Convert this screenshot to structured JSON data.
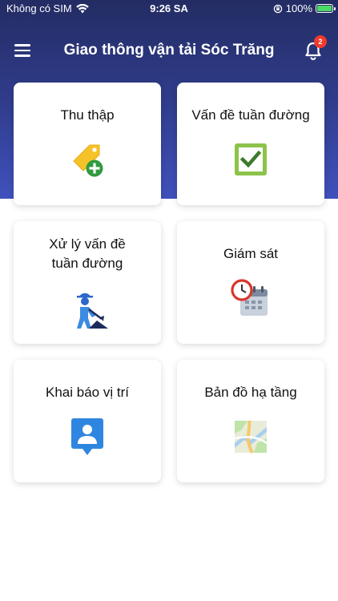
{
  "status_bar": {
    "carrier": "Không có SIM",
    "time": "9:26 SA",
    "battery": "100%",
    "battery_level": 1.0
  },
  "app_bar": {
    "title": "Giao thông vận tải Sóc Trăng",
    "notification_count": "2",
    "icons": {
      "menu": "hamburger-menu-icon",
      "notifications": "bell-icon"
    }
  },
  "colors": {
    "header_top": "#232c63",
    "header_bottom": "#4051bd",
    "badge": "#f03a2e",
    "card_bg": "#ffffff"
  },
  "menu": {
    "items": [
      {
        "label": "Thu thập",
        "icon": "tag-add-icon"
      },
      {
        "label": "Vấn đề tuần đường",
        "icon": "checkbox-icon"
      },
      {
        "label": "Xử lý vấn đề tuần đường",
        "icon": "road-worker-icon"
      },
      {
        "label": "Giám sát",
        "icon": "clock-calendar-icon"
      },
      {
        "label": "Khai báo vị trí",
        "icon": "user-location-icon"
      },
      {
        "label": "Bản đồ hạ tầng",
        "icon": "map-icon"
      }
    ]
  }
}
